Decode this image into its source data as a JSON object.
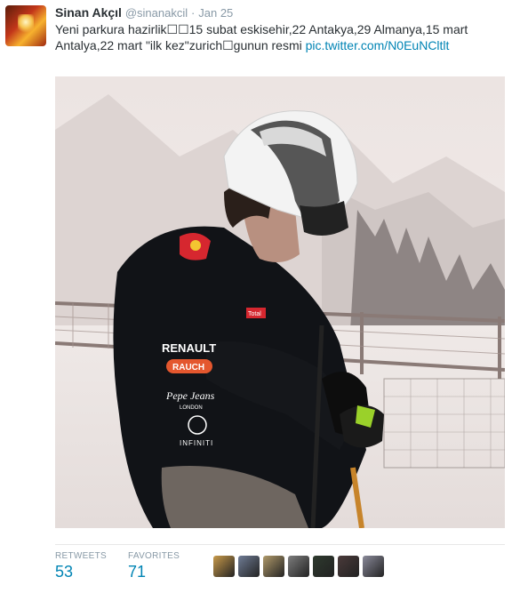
{
  "tweet": {
    "author_name": "Sinan Akçıl",
    "handle": "@sinanakcil",
    "separator": "·",
    "date": "Jan 25",
    "text_line1": "Yeni parkura hazirlik☐☐15 subat eskisehir,22 Antakya,29 Almanya,15 mart",
    "text_line2": "Antalya,22 mart \"ilk kez\"zurich☐gunun resmi ",
    "link": "pic.twitter.com/N0EuNCltlt"
  },
  "photo": {
    "logos": [
      "RENAULT",
      "RAUCH",
      "Pepe Jeans",
      "INFINITI"
    ],
    "logo_small": "LONDON",
    "tag": "Total"
  },
  "stats": {
    "retweets_label": "RETWEETS",
    "retweets": "53",
    "favorites_label": "FAVORITES",
    "favorites": "71"
  },
  "favoriters": [
    {
      "color": "#c89a4a",
      "name": "favoriter-avatar-1"
    },
    {
      "color": "#6f7c95",
      "name": "favoriter-avatar-2"
    },
    {
      "color": "#b09a6a",
      "name": "favoriter-avatar-3"
    },
    {
      "color": "#7d7d7d",
      "name": "favoriter-avatar-4"
    },
    {
      "color": "#2e3a2e",
      "name": "favoriter-avatar-5"
    },
    {
      "color": "#4a3a3a",
      "name": "favoriter-avatar-6"
    },
    {
      "color": "#8a8a9a",
      "name": "favoriter-avatar-7"
    }
  ]
}
